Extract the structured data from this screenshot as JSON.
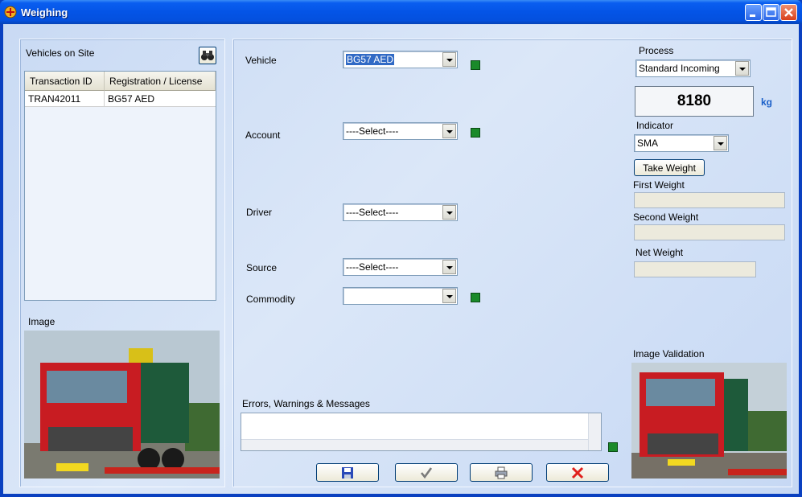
{
  "window": {
    "title": "Weighing"
  },
  "vehicles_on_site": {
    "title": "Vehicles on Site",
    "columns": [
      "Transaction ID",
      "Registration / License"
    ],
    "rows": [
      {
        "transaction_id": "TRAN42011",
        "registration": "BG57 AED"
      }
    ]
  },
  "image_section": {
    "label": "Image"
  },
  "form": {
    "vehicle": {
      "label": "Vehicle",
      "value": "BG57 AED"
    },
    "account": {
      "label": "Account",
      "value": "----Select----"
    },
    "driver": {
      "label": "Driver",
      "value": "----Select----"
    },
    "source": {
      "label": "Source",
      "value": "----Select----"
    },
    "commodity": {
      "label": "Commodity",
      "value": ""
    }
  },
  "messages": {
    "label": "Errors, Warnings & Messages"
  },
  "process": {
    "label": "Process",
    "value": "Standard Incoming"
  },
  "weight": {
    "display": "8180",
    "unit": "kg"
  },
  "indicator": {
    "label": "Indicator",
    "value": "SMA"
  },
  "take_weight": {
    "label": "Take Weight"
  },
  "first_weight": {
    "label": "First Weight",
    "value": ""
  },
  "second_weight": {
    "label": "Second Weight",
    "value": ""
  },
  "net_weight": {
    "label": "Net Weight",
    "value": ""
  },
  "image_validation": {
    "label": "Image Validation"
  },
  "toolbar": {
    "save_icon": "floppy-disk-icon",
    "confirm_icon": "checkmark-icon",
    "print_icon": "printer-icon",
    "cancel_icon": "red-x-icon"
  },
  "colors": {
    "status_led": "#1a8a2a",
    "unit_accent": "#1a5fc8",
    "cancel_red": "#e0201c"
  }
}
